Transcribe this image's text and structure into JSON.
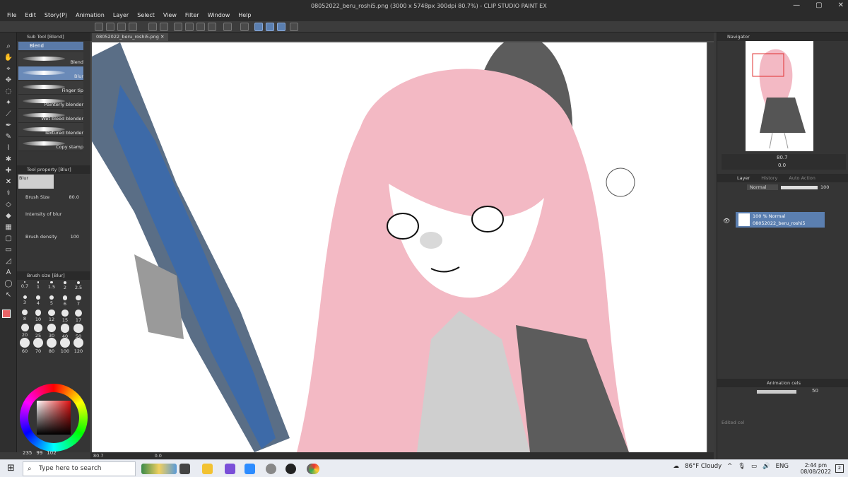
{
  "window": {
    "title": "08052022_beru_roshi5.png (3000 x 5748px 300dpi 80.7%) - CLIP STUDIO PAINT EX",
    "menu": [
      "File",
      "Edit",
      "Story(P)",
      "Animation",
      "Layer",
      "Select",
      "View",
      "Filter",
      "Window",
      "Help"
    ]
  },
  "sub_tool": {
    "header": "Sub Tool [Blend]",
    "tab": "Blend",
    "items": [
      "Blend",
      "Blur",
      "Finger tip",
      "Painterly blender",
      "Wet bleed blender",
      "Textured blender",
      "Copy stamp"
    ],
    "selected": "Blur"
  },
  "tool_property": {
    "header": "Tool property [Blur]",
    "name": "Blur",
    "brush_size_label": "Brush Size",
    "brush_size_value": "80.0",
    "intensity_label": "Intensity of blur",
    "density_label": "Brush density",
    "density_value": "100"
  },
  "brush_size_panel": {
    "header": "Brush size [Blur]",
    "sizes": [
      "0.7",
      "1",
      "1.5",
      "2",
      "2.5",
      "3",
      "4",
      "5",
      "6",
      "7",
      "8",
      "10",
      "12",
      "15",
      "17",
      "20",
      "25",
      "30",
      "40",
      "50",
      "60",
      "70",
      "80",
      "100",
      "120"
    ]
  },
  "color": {
    "r": "235",
    "g": "99",
    "b": "102",
    "main_hex": "#eb6366"
  },
  "canvas": {
    "tab": "08052022_beru_roshi5.png",
    "zoom": "80.7",
    "angle": "0.0"
  },
  "navigator": {
    "header": "Navigator",
    "zoom": "80.7",
    "rotation": "0.0"
  },
  "layer": {
    "tabs": [
      "Layer",
      "History",
      "Auto Action"
    ],
    "blend_mode": "Normal",
    "opacity": "100",
    "row_line1": "100 % Normal",
    "row_line2": "08052022_beru_roshi5"
  },
  "animation": {
    "header": "Animation cels",
    "value": "50",
    "footer": "Edited cel"
  },
  "taskbar": {
    "search_placeholder": "Type here to search",
    "weather": "86°F  Cloudy",
    "lang": "ENG",
    "time": "2:44 pm",
    "date": "08/08/2022",
    "notification_count": "2"
  }
}
